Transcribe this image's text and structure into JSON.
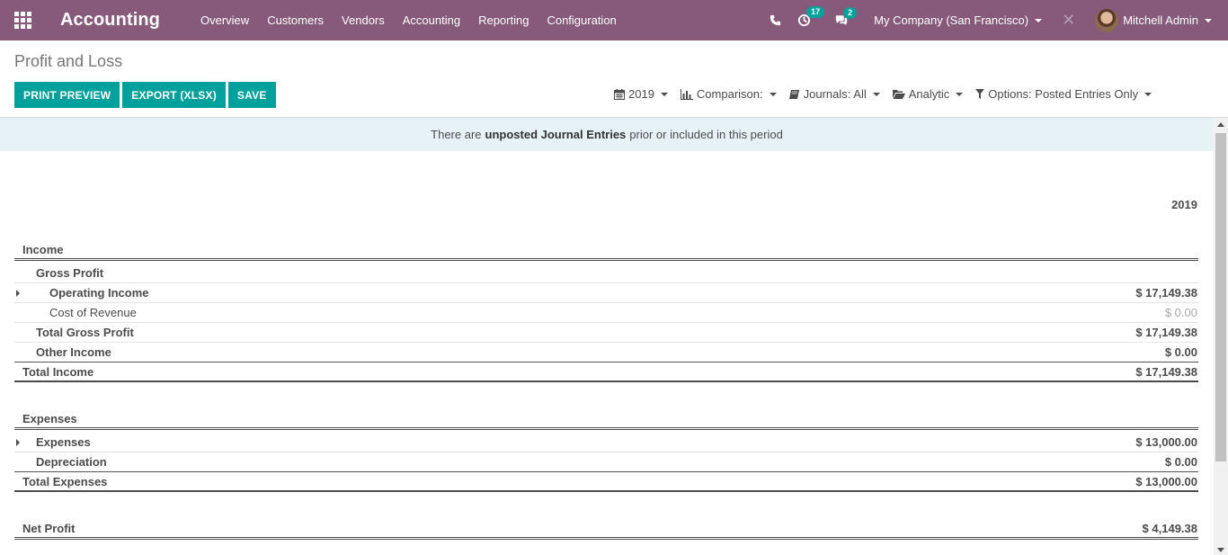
{
  "navbar": {
    "brand": "Accounting",
    "menu": [
      "Overview",
      "Customers",
      "Vendors",
      "Accounting",
      "Reporting",
      "Configuration"
    ],
    "activity_count": "17",
    "message_count": "2",
    "company": "My Company (San Francisco)",
    "user": "Mitchell Admin"
  },
  "control_panel": {
    "title": "Profit and Loss",
    "buttons": [
      "PRINT PREVIEW",
      "EXPORT (XLSX)",
      "SAVE"
    ],
    "filters": {
      "date": "2019",
      "comparison": "Comparison:",
      "journals": "Journals: All",
      "analytic": "Analytic",
      "options": "Options: Posted Entries Only"
    }
  },
  "alert": {
    "prefix": "There are",
    "emphasis": "unposted Journal Entries",
    "suffix": "prior or included in this period"
  },
  "report": {
    "column_header": "2019",
    "rows": [
      {
        "label": "Income",
        "value": ""
      },
      {
        "label": "Gross Profit",
        "value": ""
      },
      {
        "label": "Operating Income",
        "value": "$ 17,149.38"
      },
      {
        "label": "Cost of Revenue",
        "value": "$ 0.00"
      },
      {
        "label": "Total Gross Profit",
        "value": "$ 17,149.38"
      },
      {
        "label": "Other Income",
        "value": "$ 0.00"
      },
      {
        "label": "Total Income",
        "value": "$ 17,149.38"
      },
      {
        "label": "Expenses",
        "value": ""
      },
      {
        "label": "Expenses",
        "value": "$ 13,000.00"
      },
      {
        "label": "Depreciation",
        "value": "$ 0.00"
      },
      {
        "label": "Total Expenses",
        "value": "$ 13,000.00"
      },
      {
        "label": "Net Profit",
        "value": "$ 4,149.38"
      }
    ]
  },
  "colors": {
    "navbar": "#875a7b",
    "primary_button": "#00a09d",
    "alert_bg": "#e7f2f7"
  }
}
